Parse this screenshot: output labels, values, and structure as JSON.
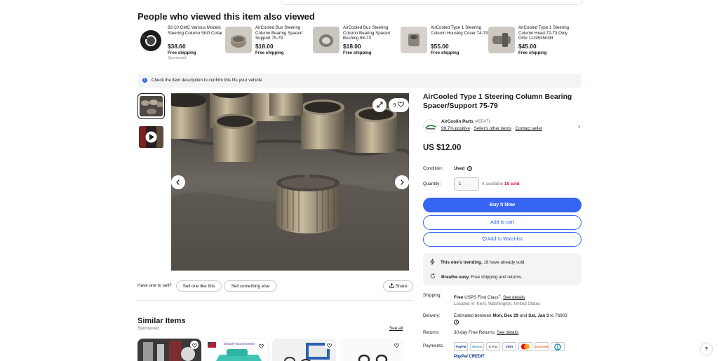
{
  "also_viewed": {
    "title": "People who viewed this item also viewed",
    "items": [
      {
        "name": "82-10 GMC Various Models Steering Column Shift Collar",
        "price": "$38.60",
        "shipping": "Free shipping",
        "sponsored": "Sponsored"
      },
      {
        "name": "AirCooled Bus Steering Column Bearing Spacer/ Support 75-79",
        "price": "$18.00",
        "shipping": "Free shipping",
        "sponsored": ""
      },
      {
        "name": "AirCooled Bus Steering Column Bearing Spacer/ Bushing 68-73",
        "price": "$18.00",
        "shipping": "Free shipping",
        "sponsored": ""
      },
      {
        "name": "AirCooled Type 1 Steering Column Housing Cover 74-79",
        "price": "$55.00",
        "shipping": "Free shipping",
        "sponsored": ""
      },
      {
        "name": "AirCooled Type 1 Steering Column Head 72-73 Only OG# 111953503H",
        "price": "$45.00",
        "shipping": "Free shipping",
        "sponsored": ""
      }
    ]
  },
  "notice": {
    "text": "Check the item description to confirm this fits your vehicle",
    "icon": "info-icon"
  },
  "gallery": {
    "watch_count": "9"
  },
  "sell": {
    "label": "Have one to sell?",
    "sell_one": "Sell one like this",
    "sell_something": "Sell something else",
    "share": "Share"
  },
  "similar": {
    "title": "Similar Items",
    "sponsored": "Sponsored",
    "see_all": "See all",
    "card2_text": "beaulty-accessories"
  },
  "listing": {
    "title": "AirCooled Type 1 Steering Column Bearing Spacer/Support 75-79",
    "seller_name": "AirCoolin Parts",
    "seller_count": "(45547)",
    "positive": "99.7% positive",
    "other_items": "Seller's other items",
    "contact": "Contact seller",
    "price": "US $12.00",
    "condition_label": "Condition:",
    "condition_value": "Used",
    "quantity_label": "Quantity:",
    "quantity_value": "1",
    "available": "4 available",
    "sold": "18 sold",
    "buy_now": "Buy It Now",
    "add_cart": "Add to cart",
    "add_watch": "Add to Watchlist",
    "trend_bold": "This one's trending.",
    "trend_text": "18 have already sold.",
    "breathe_bold": "Breathe easy.",
    "breathe_text": "Free shipping and returns.",
    "shipping_label": "Shipping:",
    "shipping_free": "Free",
    "shipping_method": "USPS First Class",
    "shipping_reg": "®",
    "see_details": "See details",
    "location": "Located in: Kent, Washington, United States",
    "delivery_label": "Delivery:",
    "delivery_prefix": "Estimated between",
    "delivery_from": "Mon, Dec 29",
    "delivery_and": "and",
    "delivery_to": "Sat, Jan 3",
    "delivery_zip": "to 76903",
    "returns_label": "Returns:",
    "returns_text": "30-day Free Returns.",
    "returns_details": "See details",
    "payments_label": "Payments:",
    "payments": [
      "PayPal",
      "Venmo",
      "G Pay",
      "VISA",
      "MC",
      "DISCOVER",
      "Diners"
    ],
    "paypal_credit": "PayPal CREDIT"
  },
  "help": "?"
}
